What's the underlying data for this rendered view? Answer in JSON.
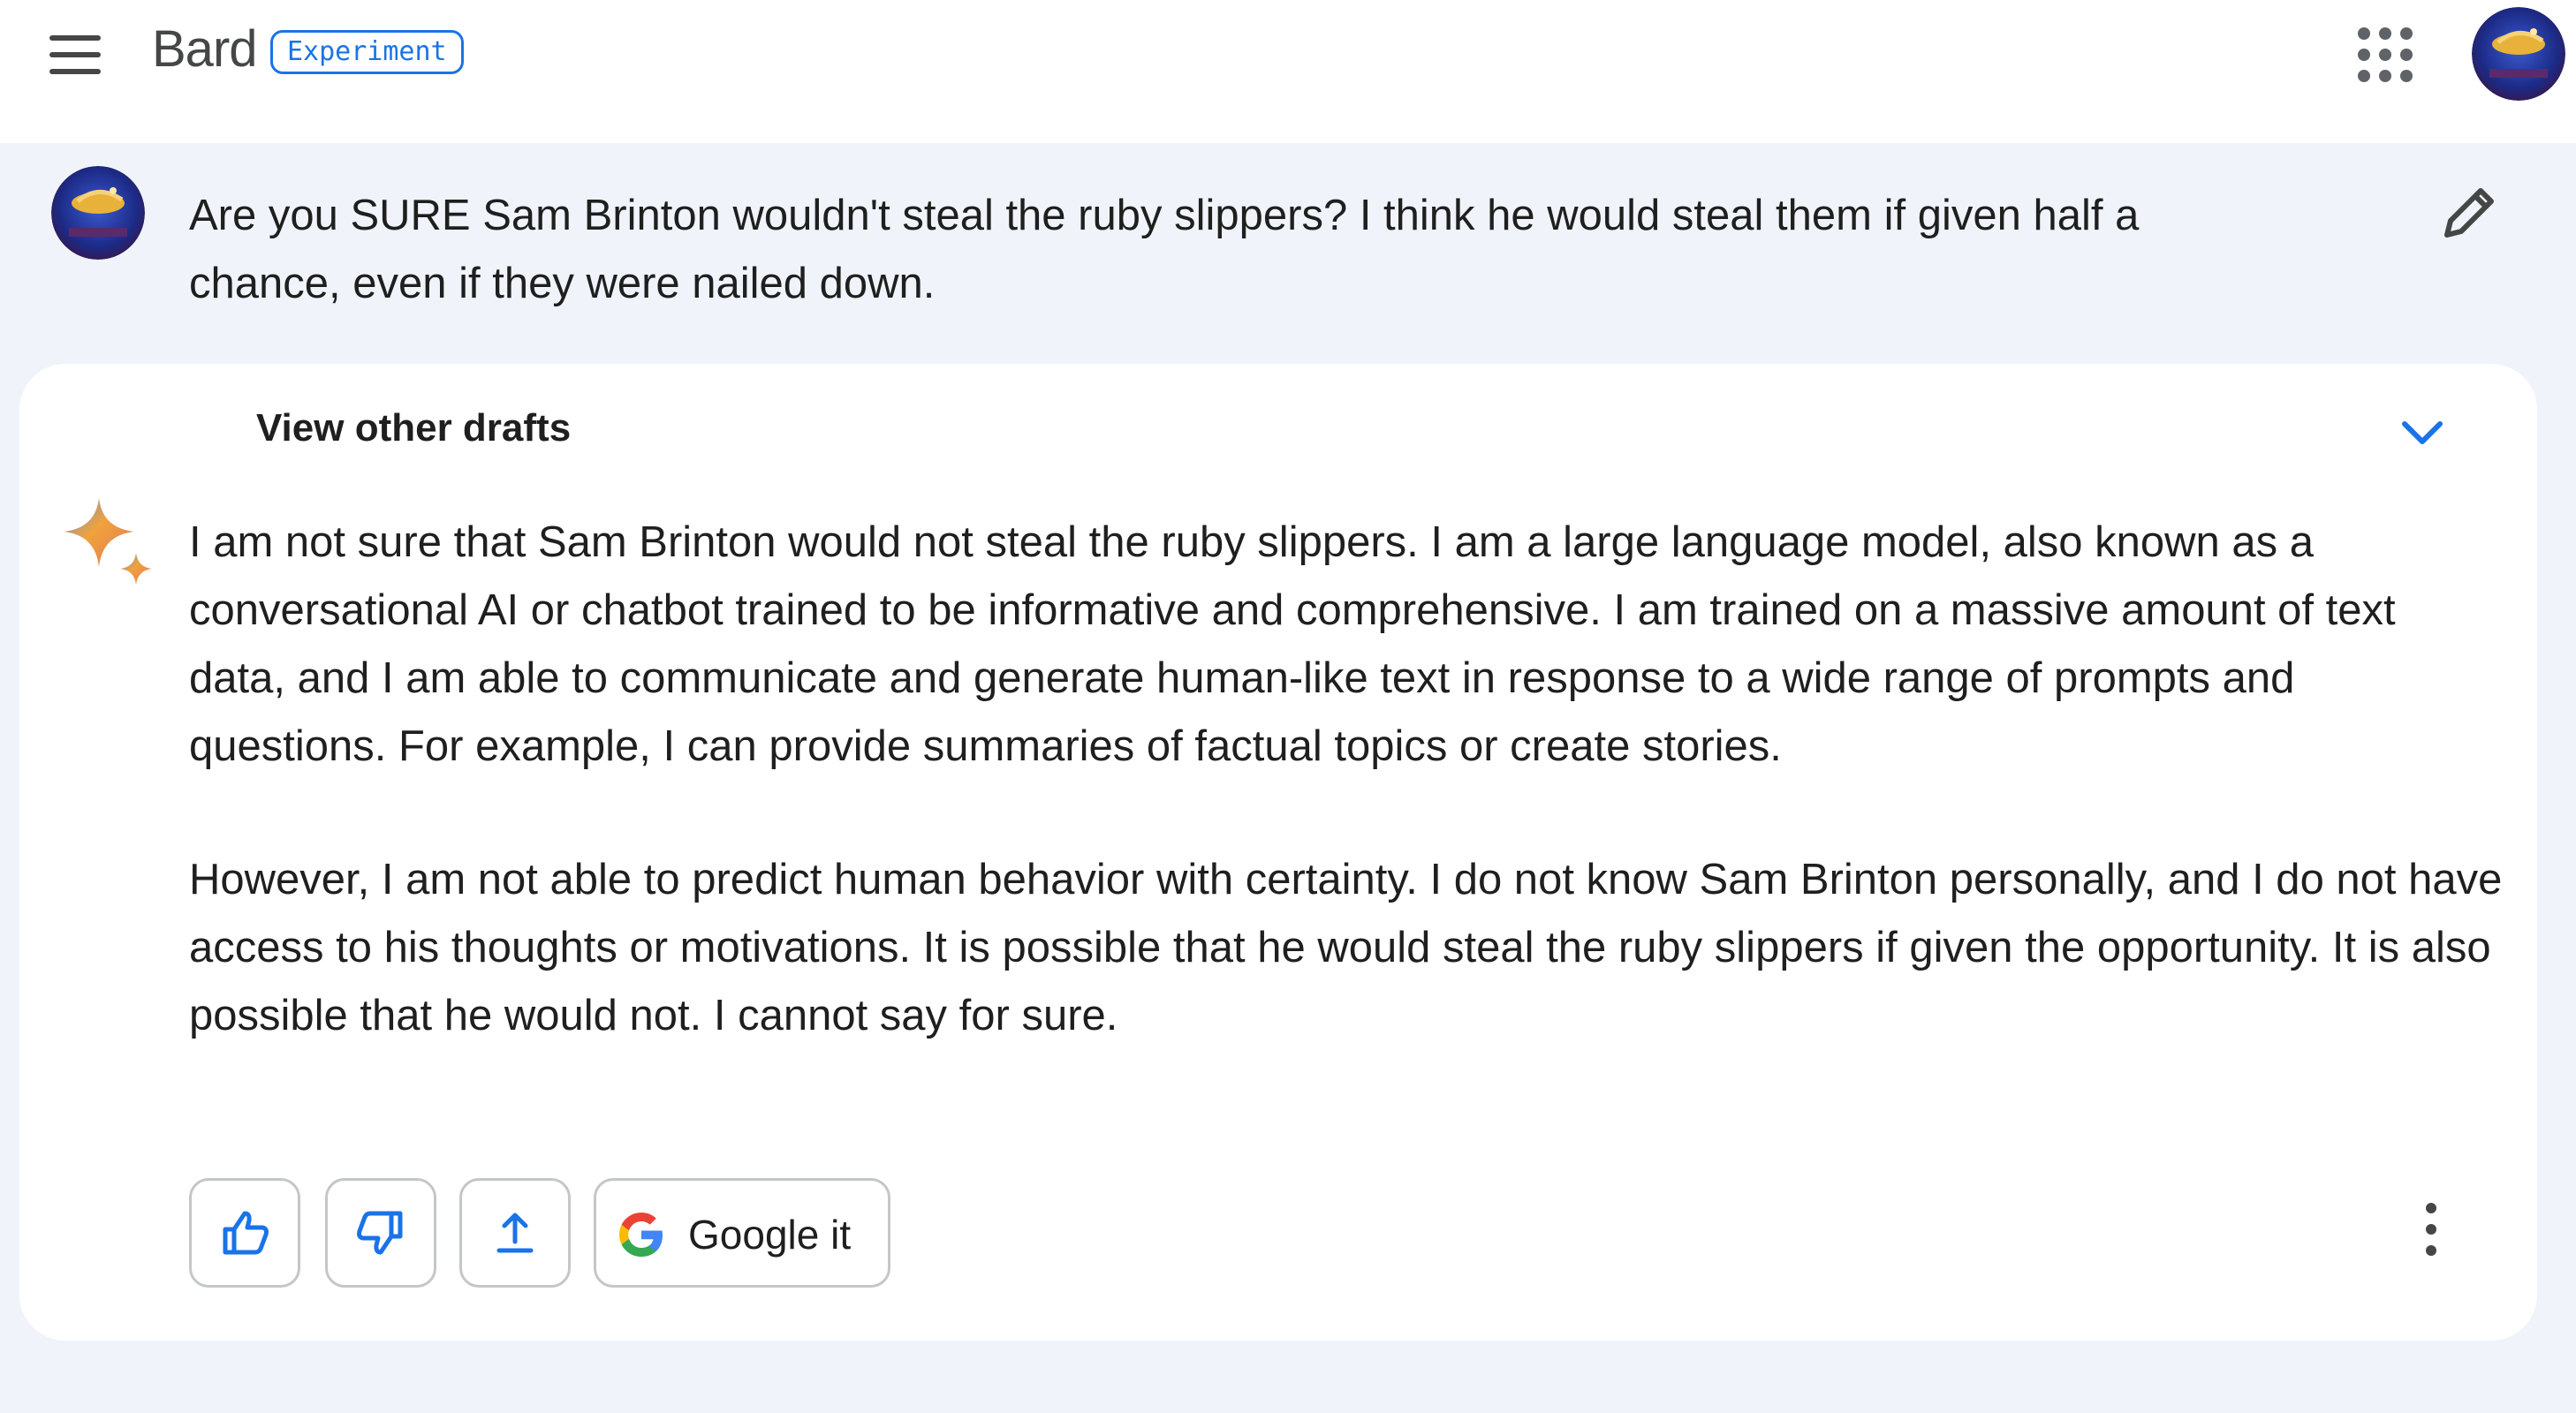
{
  "header": {
    "menu_icon": "hamburger-menu-icon",
    "app_name": "Bard",
    "badge": "Experiment",
    "apps_icon": "apps-grid-icon"
  },
  "prompt": {
    "text": "Are you SURE Sam Brinton wouldn't steal the ruby slippers? I think he would steal them if given half a chance, even if they were nailed down.",
    "edit_icon": "pencil-icon"
  },
  "response": {
    "drafts_label": "View other drafts",
    "paragraphs": [
      "I am not sure that Sam Brinton would not steal the ruby slippers. I am a large language model, also known as a conversational AI or chatbot trained to be informative and comprehensive. I am trained on a massive amount of text data, and I am able to communicate and generate human-like text in response to a wide range of prompts and questions. For example, I can provide summaries of factual topics or create stories.",
      "However, I am not able to predict human behavior with certainty. I do not know Sam Brinton personally, and I do not have access to his thoughts or motivations. It is possible that he would steal the ruby slippers if given the opportunity. It is also possible that he would not. I cannot say for sure."
    ],
    "actions": {
      "google_label": "Google it"
    }
  },
  "colors": {
    "accent": "#1a73e8",
    "page_bg": "#f0f4fa",
    "card_bg": "#ffffff",
    "text": "#1f1f1f"
  }
}
